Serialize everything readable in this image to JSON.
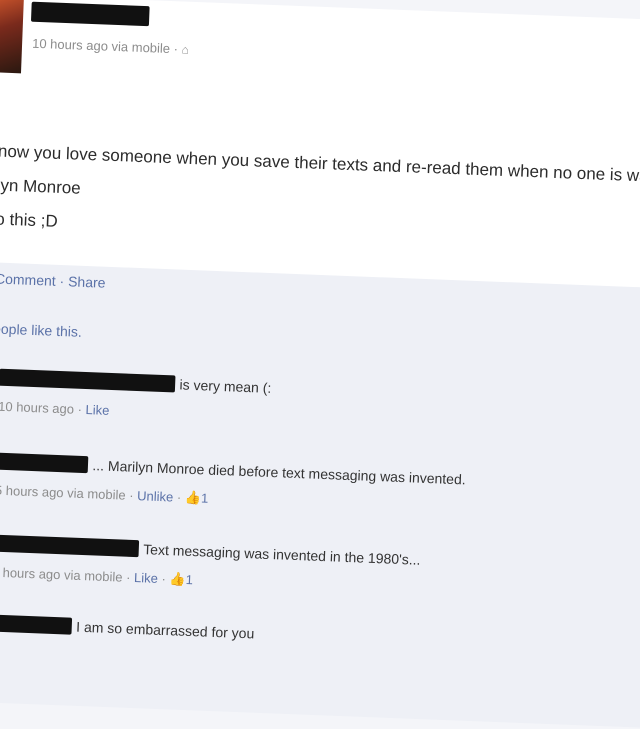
{
  "post": {
    "meta": "10 hours ago via mobile · ",
    "lines": [
      "now you love someone when you save their texts and re-read them when no one is watching.",
      "lyn Monroe",
      "o this ;D"
    ]
  },
  "actions": {
    "comment": "Comment",
    "separator": " · ",
    "share": "Share"
  },
  "likes": "eople like this.",
  "comments": [
    {
      "text": "is very mean (:",
      "meta": "10 hours ago · ",
      "like": "Like",
      "count": ""
    },
    {
      "text": "... Marilyn Monroe died before text messaging was invented.",
      "meta": "5 hours ago via mobile · ",
      "like": "Unlike",
      "count": "1"
    },
    {
      "text": "Text messaging was invented in the 1980's...",
      "meta": "4 hours ago via mobile · ",
      "like": "Like",
      "count": "1"
    },
    {
      "text": "I am so embarrassed for you",
      "meta": "",
      "like": "",
      "count": ""
    }
  ],
  "icons": {
    "globe": "mobile-icon",
    "thumb": "thumbs-up-icon"
  },
  "colors": {
    "link": "#5b72a8",
    "meta": "#8c8c8c",
    "redaction": "#111111"
  }
}
